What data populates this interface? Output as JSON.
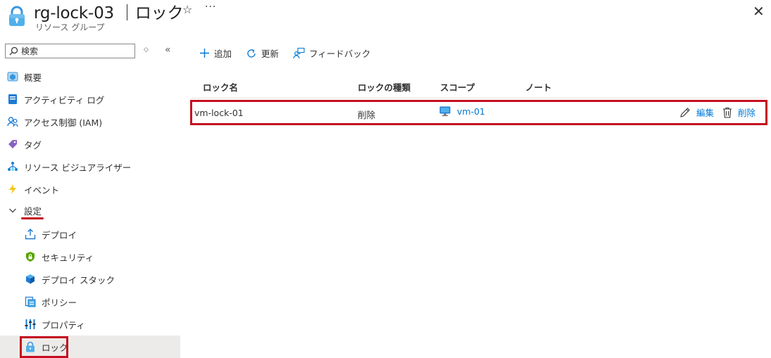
{
  "header": {
    "title": "rg-lock-03 ｜ロック",
    "subtitle": "リソース グループ",
    "star_icon": "☆",
    "more_icon": "···",
    "close_icon": "✕"
  },
  "sidebar": {
    "search_placeholder": "検索",
    "sort_icon": "◇",
    "collapse_icon": "«",
    "items": [
      {
        "label": "概要",
        "icon": "overview-icon"
      },
      {
        "label": "アクティビティ ログ",
        "icon": "activity-log-icon"
      },
      {
        "label": "アクセス制御 (IAM)",
        "icon": "iam-icon"
      },
      {
        "label": "タグ",
        "icon": "tag-icon"
      },
      {
        "label": "リソース ビジュアライザー",
        "icon": "resource-visualizer-icon"
      },
      {
        "label": "イベント",
        "icon": "events-icon"
      }
    ],
    "section": {
      "label": "設定",
      "icon": "chevron-down-icon",
      "expanded": true
    },
    "sub_items": [
      {
        "label": "デプロイ",
        "icon": "deploy-icon"
      },
      {
        "label": "セキュリティ",
        "icon": "security-icon"
      },
      {
        "label": "デプロイ スタック",
        "icon": "deploy-stack-icon"
      },
      {
        "label": "ポリシー",
        "icon": "policy-icon"
      },
      {
        "label": "プロパティ",
        "icon": "properties-icon"
      },
      {
        "label": "ロック",
        "icon": "lock-icon",
        "active": true
      }
    ]
  },
  "toolbar": {
    "add_label": "追加",
    "refresh_label": "更新",
    "feedback_label": "フィードバック"
  },
  "table": {
    "columns": [
      "ロック名",
      "ロックの種類",
      "スコープ",
      "ノート"
    ],
    "rows": [
      {
        "name": "vm-lock-01",
        "type": "削除",
        "scope": "vm-01",
        "note": "",
        "edit_label": "編集",
        "delete_label": "削除"
      }
    ]
  },
  "colors": {
    "accent": "#0078d4",
    "highlight_red": "#c50f1f",
    "active_bg": "#edebe9"
  }
}
